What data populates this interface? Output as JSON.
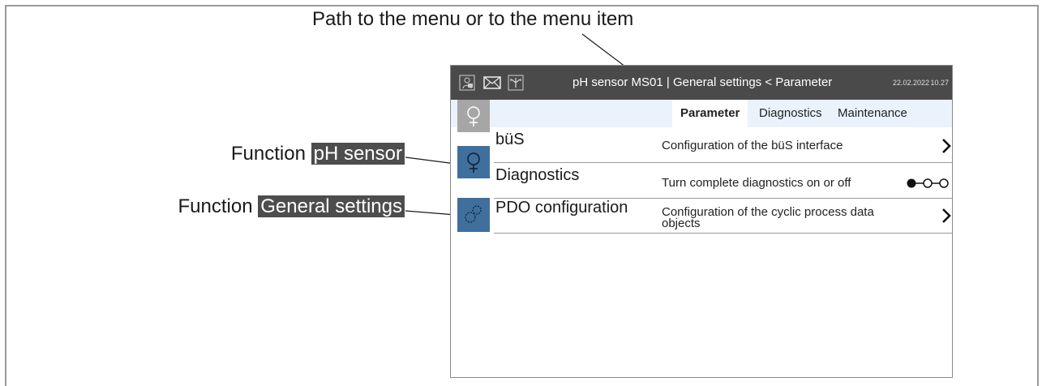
{
  "callouts": {
    "top": "Path to the menu or to the menu item",
    "ph_prefix": "Function",
    "ph_highlight": "pH sensor",
    "gs_prefix": "Function",
    "gs_highlight": "General settings"
  },
  "titlebar": {
    "icons": [
      "user-lock-icon",
      "mail-icon",
      "network-icon"
    ],
    "title": "pH sensor MS01 | General settings < Parameter",
    "date": "22.02.2022",
    "time": "10.27"
  },
  "tabs": [
    {
      "label": "Parameter",
      "active": true
    },
    {
      "label": "Diagnostics",
      "active": false
    },
    {
      "label": "Maintenance",
      "active": false
    }
  ],
  "sidebar": {
    "items": [
      {
        "icon": "ph-sensor-icon",
        "state": "inactive"
      },
      {
        "icon": "ph-sensor-icon",
        "state": "selected"
      },
      {
        "icon": "general-settings-icon",
        "state": "selected"
      }
    ]
  },
  "rows": [
    {
      "name": "büS",
      "description": "Configuration of the büS interface",
      "control": "chevron-right-icon"
    },
    {
      "name": "Diagnostics",
      "description": "Turn complete diagnostics on or off",
      "control": "toggle-icon"
    },
    {
      "name": "PDO configuration",
      "description": "Configuration of the cyclic process data objects",
      "control": "chevron-right-icon"
    }
  ],
  "colors": {
    "titlebar": "#4a4a4a",
    "tabbar": "#eaf3fb",
    "sidebar_active": "#3f6f9c",
    "sidebar_inactive": "#a6a6a6",
    "highlight": "#4d4d4d"
  }
}
